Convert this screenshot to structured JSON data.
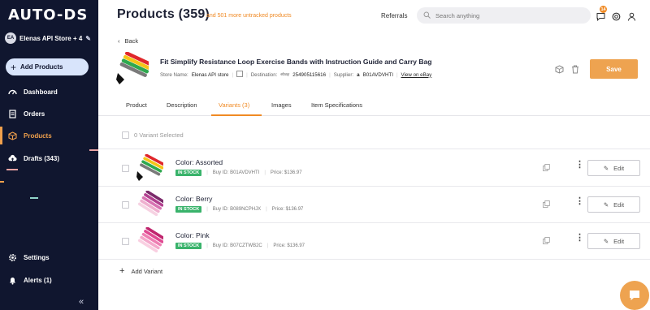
{
  "sidebar": {
    "logo": "AUTO-DS",
    "store_avatar": "EA",
    "store_name": "Elenas API Store + 4",
    "add_products": "Add Products",
    "nav": [
      {
        "label": "Dashboard",
        "icon": "dashboard-icon"
      },
      {
        "label": "Orders",
        "icon": "orders-icon"
      },
      {
        "label": "Products",
        "icon": "products-box-icon",
        "active": true
      },
      {
        "label": "Drafts (343)",
        "icon": "cloud-upload-icon"
      }
    ],
    "bottom_nav": [
      {
        "label": "Settings",
        "icon": "gear-icon"
      },
      {
        "label": "Alerts (1)",
        "icon": "bell-icon"
      }
    ],
    "collapse": "«"
  },
  "header": {
    "title": "Products (359)",
    "untracked": "and 501 more untracked products",
    "referrals": "Referrals",
    "search_placeholder": "Search anything",
    "notification_count": "14"
  },
  "product": {
    "back": "Back",
    "title": "Fit Simplify Resistance Loop Exercise Bands with Instruction Guide and Carry Bag",
    "store_label": "Store Name:",
    "store_value": "Elenas API store",
    "destination_label": "Destination:",
    "destination_value": "254905115616",
    "supplier_label": "Supplier:",
    "supplier_value": "B01AVDVHTI",
    "view_link": "View on eBay",
    "save": "Save"
  },
  "tabs": [
    "Product",
    "Description",
    "Variants (3)",
    "Images",
    "Item Specifications"
  ],
  "active_tab": "Variants (3)",
  "variants_selected": "0  Variant Selected",
  "variants": [
    {
      "name": "Color: Assorted",
      "status": "IN STOCK",
      "buy_id": "Buy ID: B01AVDVHTI",
      "price": "Price: $136.97",
      "edit": "Edit"
    },
    {
      "name": "Color: Berry",
      "status": "IN STOCK",
      "buy_id": "Buy ID: B089NCPHJX",
      "price": "Price: $136.97",
      "edit": "Edit"
    },
    {
      "name": "Color: Pink",
      "status": "IN STOCK",
      "buy_id": "Buy ID: B07CZTWB2C",
      "price": "Price: $136.97",
      "edit": "Edit"
    }
  ],
  "add_variant": "Add Variant",
  "colors": {
    "sidebar_bg": "#10162f",
    "accent": "#eea350",
    "in_stock": "#39b36b"
  }
}
